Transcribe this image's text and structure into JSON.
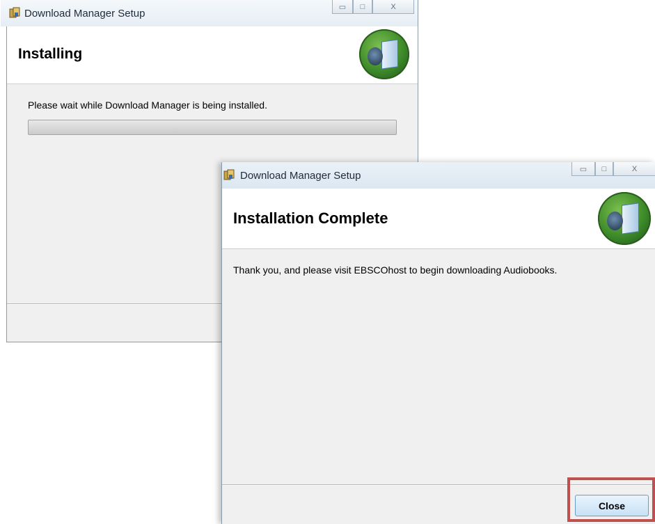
{
  "window_back": {
    "title": "Download Manager Setup",
    "heading": "Installing",
    "message": "Please wait while Download Manager is being installed.",
    "controls": {
      "minimize": "▭",
      "maximize": "□",
      "close": "X"
    }
  },
  "window_front": {
    "title": "Download Manager Setup",
    "heading": "Installation Complete",
    "message": "Thank you, and please visit EBSCOhost to begin downloading Audiobooks.",
    "controls": {
      "minimize": "▭",
      "maximize": "□",
      "close": "X"
    },
    "close_button_label": "Close"
  },
  "colors": {
    "highlight": "#c0504d",
    "logo_green": "#3d8a2a"
  }
}
